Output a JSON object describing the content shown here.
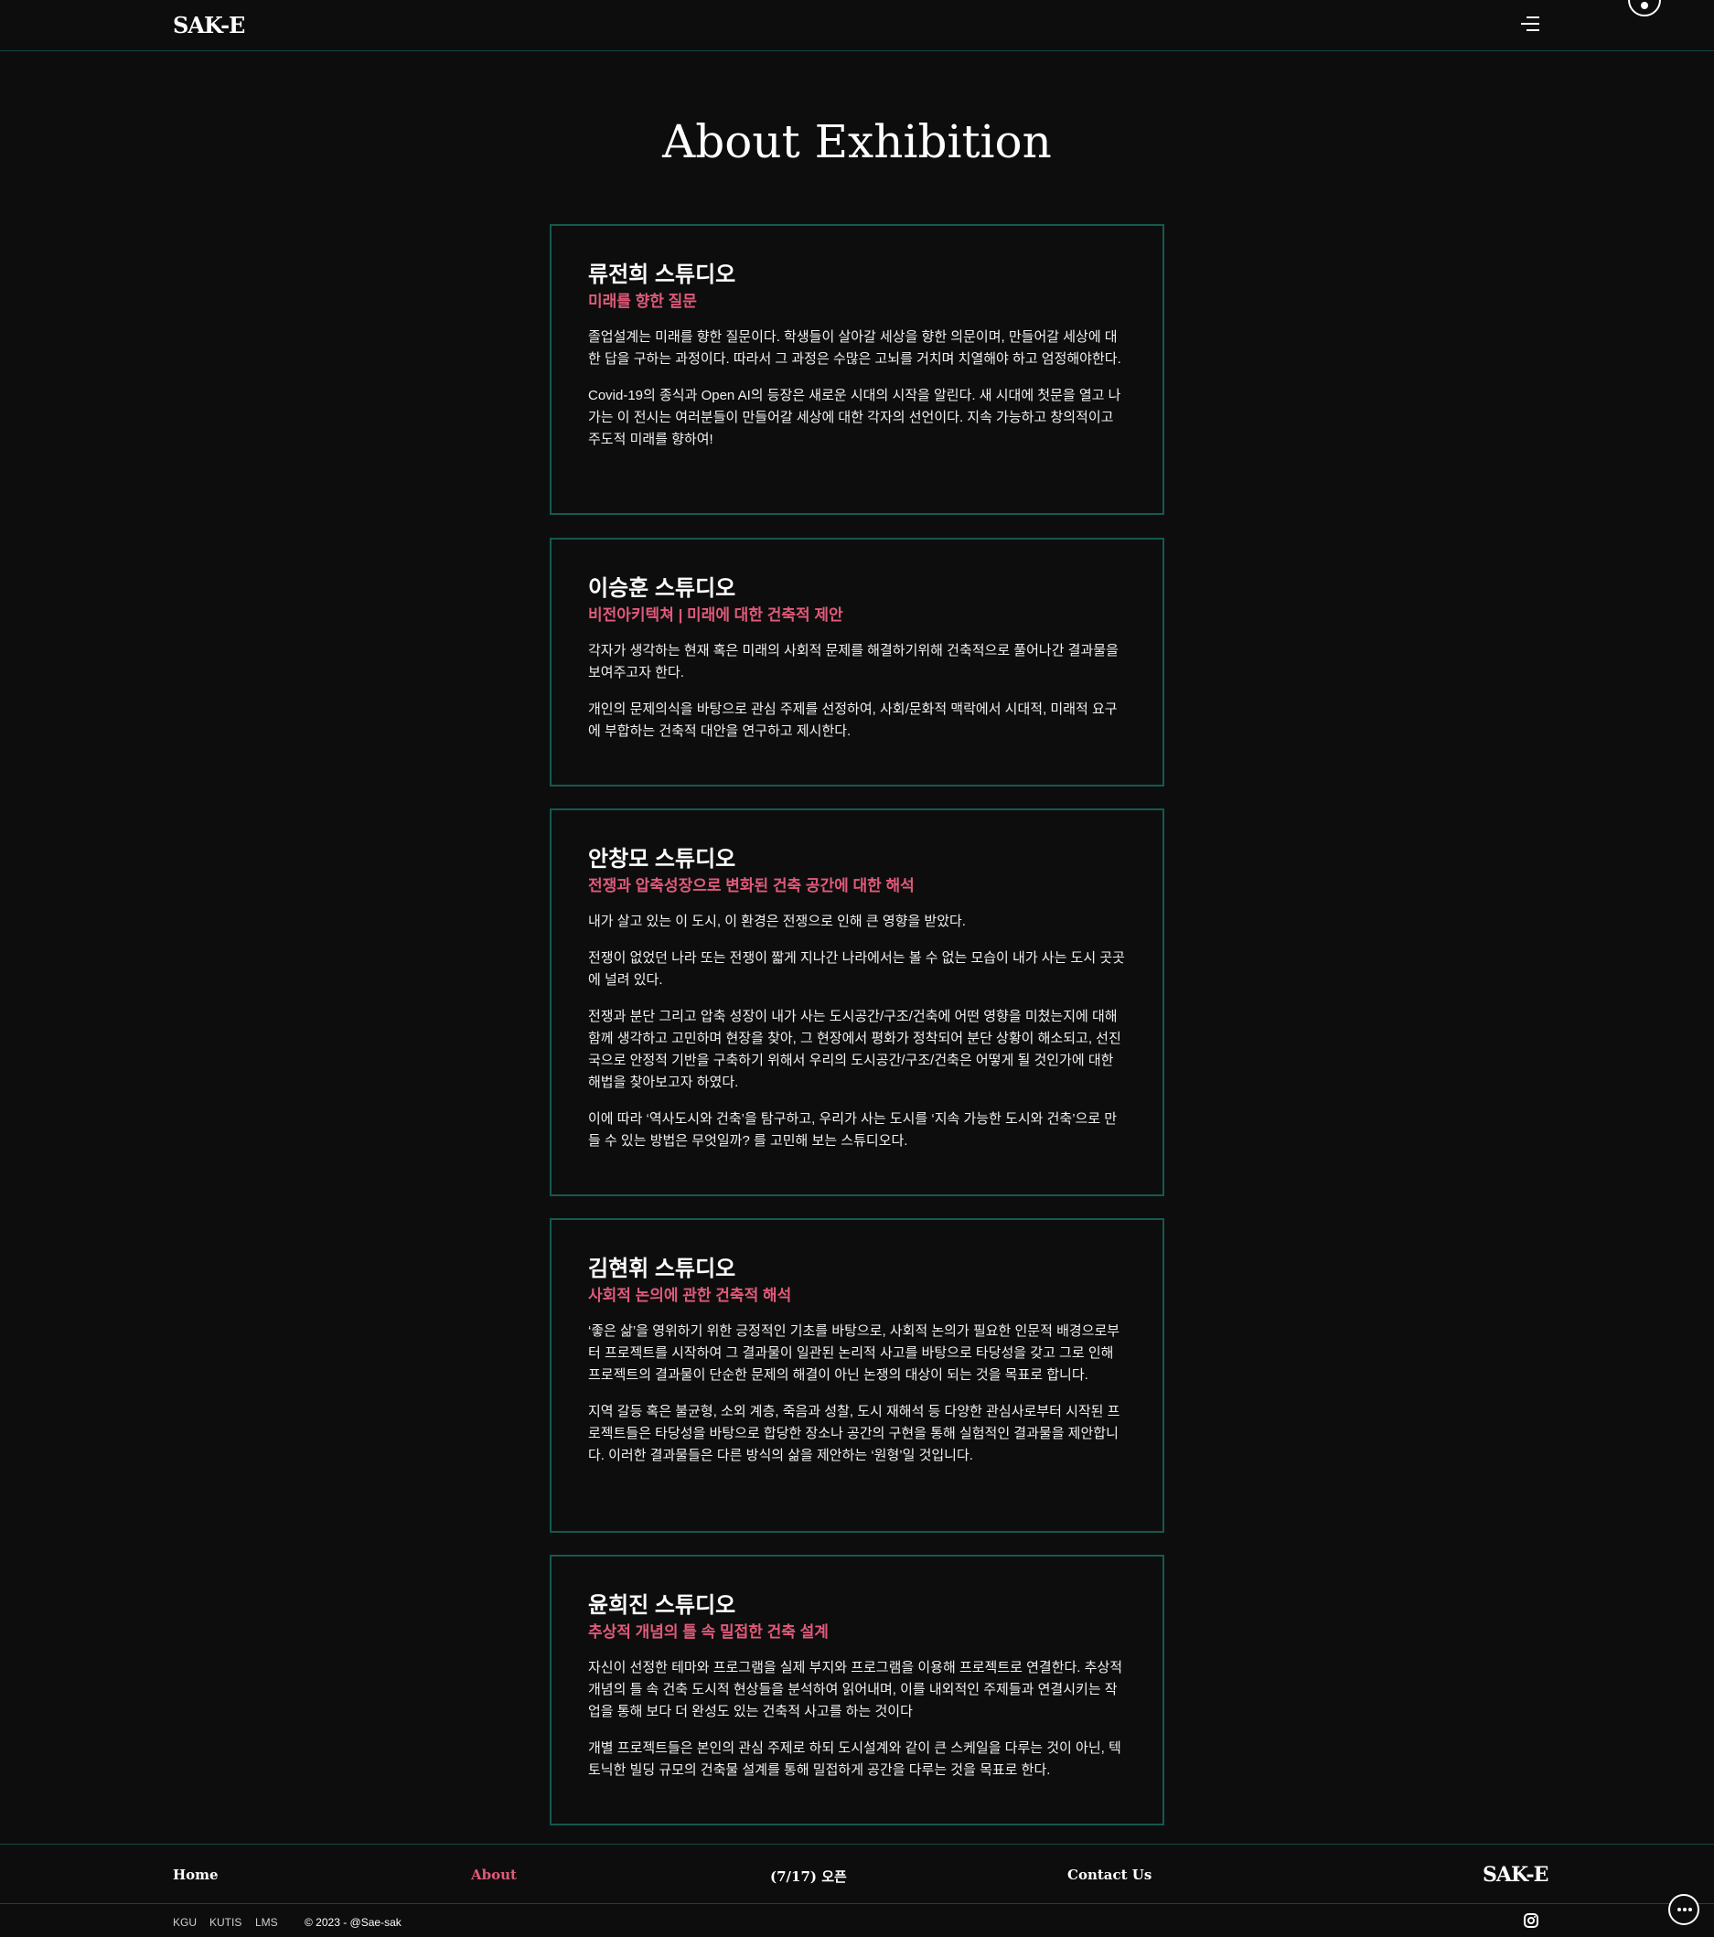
{
  "header": {
    "logo": "SAK-E",
    "menu_icon": "hamburger-menu-icon",
    "toggle_icon": "circle-dot-toggle-icon"
  },
  "page": {
    "title": "About Exhibition"
  },
  "studios": [
    {
      "name": "류전희 스튜디오",
      "subtitle": "미래를 향한 질문",
      "paragraphs": [
        "졸업설계는 미래를 향한 질문이다. 학생들이 살아갈 세상을 향한 의문이며, 만들어갈 세상에 대한 답을 구하는 과정이다. 따라서 그 과정은 수많은 고뇌를 거치며 치열해야 하고 엄정해야한다.",
        "Covid-19의 종식과 Open AI의 등장은 새로운 시대의 시작을 알린다. 새 시대에 첫문을 열고 나가는 이 전시는 여러분들이 만들어갈 세상에 대한 각자의 선언이다. 지속 가능하고 창의적이고 주도적 미래를 향하여!"
      ]
    },
    {
      "name": "이승훈 스튜디오",
      "subtitle": "비전아키텍쳐 | 미래에 대한 건축적 제안",
      "paragraphs": [
        "각자가 생각하는 현재 혹은 미래의 사회적 문제를 해결하기위해 건축적으로 풀어나간 결과물을 보여주고자 한다.",
        "개인의 문제의식을 바탕으로 관심 주제를 선정하여, 사회/문화적 맥락에서 시대적, 미래적 요구에 부합하는 건축적 대안을 연구하고 제시한다."
      ]
    },
    {
      "name": "안창모 스튜디오",
      "subtitle": "전쟁과 압축성장으로 변화된 건축 공간에 대한 해석",
      "paragraphs": [
        "내가 살고 있는 이 도시, 이 환경은 전쟁으로 인해 큰 영향을 받았다.",
        "전쟁이 없었던 나라 또는 전쟁이 짧게 지나간 나라에서는 볼 수 없는 모습이 내가 사는 도시 곳곳에 널려 있다.",
        "전쟁과 분단 그리고 압축 성장이 내가 사는 도시공간/구조/건축에 어떤 영향을 미쳤는지에 대해 함께 생각하고 고민하며 현장을 찾아, 그 현장에서 평화가 정착되어 분단 상황이 해소되고, 선진국으로 안정적 기반을 구축하기 위해서 우리의 도시공간/구조/건축은 어떻게 될 것인가에 대한 해법을 찾아보고자 하였다.",
        "이에 따라 ‘역사도시와 건축’을 탐구하고, 우리가 사는 도시를 ‘지속 가능한 도시와 건축’으로 만들 수 있는 방법은 무엇일까? 를 고민해 보는 스튜디오다."
      ]
    },
    {
      "name": "김현휘 스튜디오",
      "subtitle": "사회적 논의에 관한 건축적 해석",
      "paragraphs": [
        "‘좋은 삶’을 영위하기 위한 긍정적인 기초를 바탕으로, 사회적 논의가 필요한 인문적 배경으로부터 프로젝트를 시작하여 그 결과물이 일관된 논리적 사고를 바탕으로 타당성을 갖고 그로 인해 프로젝트의 결과물이 단순한 문제의 해결이 아닌 논쟁의 대상이 되는 것을 목표로 합니다.",
        "지역 갈등 혹은 불균형, 소외 계층, 죽음과 성찰, 도시 재해석 등 다양한 관심사로부터 시작된 프로젝트들은 타당성을 바탕으로 합당한 장소나 공간의 구현을 통해 실험적인 결과물을 제안합니다. 이러한 결과물들은 다른 방식의 삶을 제안하는 ‘원형’일 것입니다."
      ]
    },
    {
      "name": "윤희진 스튜디오",
      "subtitle": "추상적 개념의 틀 속 밀접한 건축 설계",
      "paragraphs": [
        "자신이 선정한 테마와 프로그램을 실제 부지와 프로그램을 이용해 프로젝트로 연결한다. 추상적 개념의 틀 속 건축 도시적 현상들을 분석하여 읽어내며, 이를 내외적인 주제들과 연결시키는 작업을 통해 보다 더 완성도 있는 건축적 사고를 하는 것이다",
        "개별 프로젝트들은 본인의 관심 주제로 하되 도시설계와 같이 큰 스케일을 다루는 것이 아닌, 텍토닉한 빌딩 규모의 건축물 설계를 통해 밀접하게 공간을 다루는 것을 목표로 한다."
      ]
    }
  ],
  "footer": {
    "nav": [
      "Home",
      "About",
      "(7/17) 오픈",
      "Contact Us"
    ],
    "logo": "SAK-E",
    "links": [
      "KGU",
      "KUTIS",
      "LMS"
    ],
    "copyright": "© 2023 - @Sae-sak",
    "instagram_icon": "instagram-icon",
    "chat_icon": "chat-bubble-icon",
    "accent_color": "#e05a7a",
    "border_color": "#14594f"
  }
}
